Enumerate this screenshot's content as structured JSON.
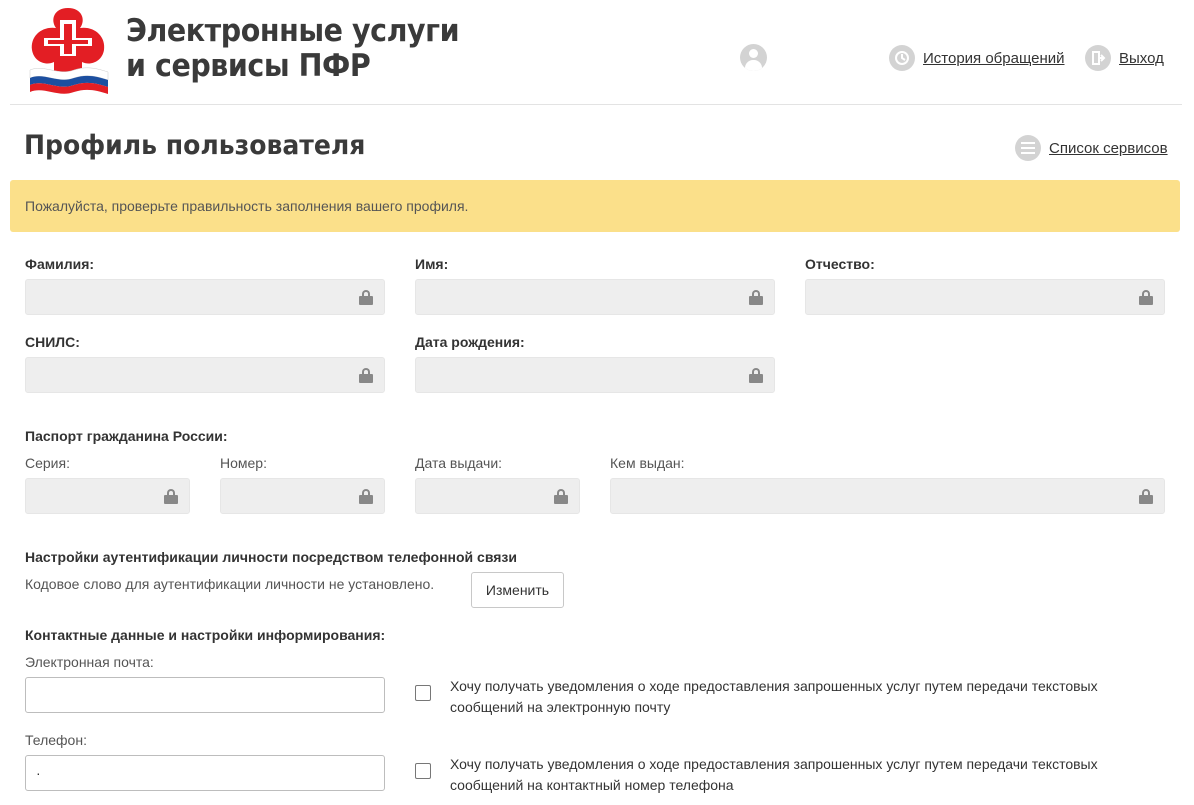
{
  "header": {
    "brand_line1": "Электронные услуги",
    "brand_line2": "и сервисы ПФР",
    "history_label": "История обращений",
    "exit_label": "Выход",
    "logo_icon": "pfr-logo-icon",
    "user_icon": "user-icon"
  },
  "page": {
    "title": "Профиль пользователя",
    "services_label": "Список сервисов"
  },
  "alert": {
    "text": "Пожалуйста, проверьте правильность заполнения вашего профиля.",
    "color": "#fbe08a"
  },
  "personal": {
    "last_name_label": "Фамилия:",
    "first_name_label": "Имя:",
    "middle_name_label": "Отчество:",
    "snils_label": "СНИЛС:",
    "birth_date_label": "Дата рождения:"
  },
  "passport": {
    "heading": "Паспорт гражданина России:",
    "series_label": "Серия:",
    "number_label": "Номер:",
    "issue_date_label": "Дата выдачи:",
    "issued_by_label": "Кем выдан:"
  },
  "auth": {
    "heading": "Настройки аутентификации личности посредством телефонной связи",
    "status_text": "Кодовое слово для аутентификации личности не установлено.",
    "change_button": "Изменить"
  },
  "contacts": {
    "heading": "Контактные данные и настройки информирования:",
    "email_label": "Электронная почта:",
    "email_value": "",
    "email_notify_text": "Хочу получать уведомления о ходе предоставления запрошенных услуг путем передачи текстовых сообщений на электронную почту",
    "phone_label": "Телефон:",
    "phone_value": "·",
    "phone_notify_text": "Хочу получать уведомления о ходе предоставления запрошенных услуг путем передачи текстовых сообщений на контактный номер телефона"
  },
  "colors": {
    "locked_field": "#eeeeee",
    "icon_gray": "#d3d3d3",
    "logo_red": "#e31e24",
    "logo_blue": "#1c4fa0"
  }
}
